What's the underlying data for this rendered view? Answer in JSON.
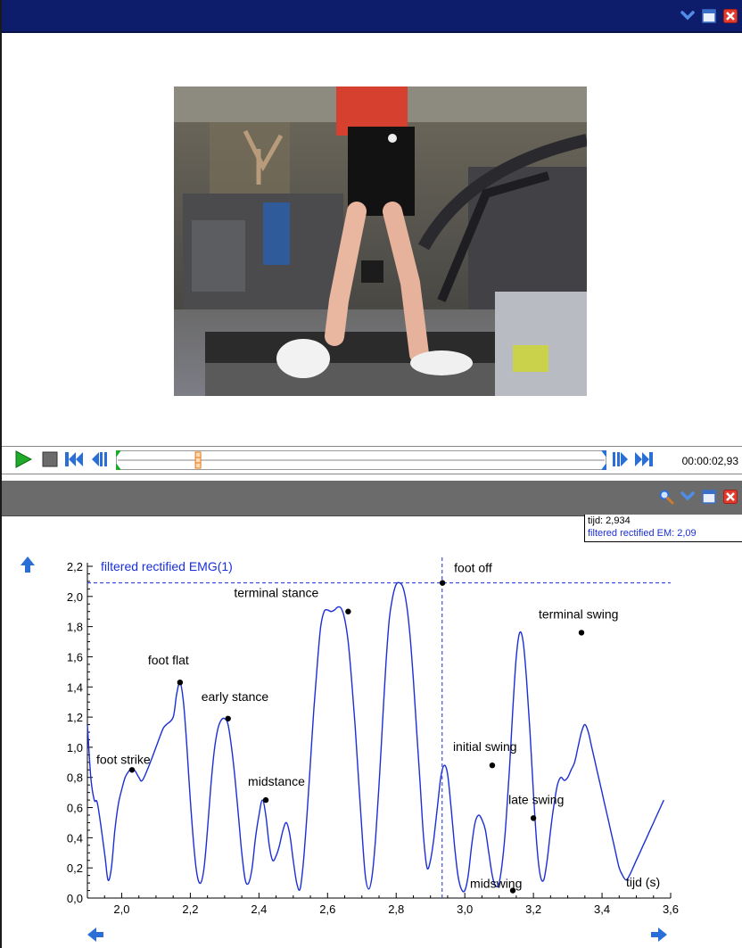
{
  "video": {
    "timecode": "00:00:02,93",
    "progress": 0.16
  },
  "tooltip": {
    "line1": "tijd: 2,934",
    "line2": "filtered rectified EM: 2,09"
  },
  "colors": {
    "video_titlebar": "#0d1d6b",
    "chart_titlebar": "#6b6b6b",
    "series": "#1a2fd6",
    "play_green": "#1faa2a",
    "nav_blue": "#2b6fd6"
  },
  "icons": {
    "video_titlebar": [
      "chevron-down-icon",
      "maximize-icon",
      "close-icon"
    ],
    "chart_titlebar": [
      "zoom-icon",
      "chevron-down-icon",
      "maximize-icon",
      "close-icon"
    ],
    "controls": [
      "play-icon",
      "stop-icon",
      "skip-start-icon",
      "step-back-icon",
      "step-forward-icon",
      "skip-end-icon"
    ]
  },
  "chart_data": {
    "type": "line",
    "series": [
      {
        "name": "filtered rectified EMG(1)",
        "x": [
          1.9,
          1.91,
          1.92,
          1.93,
          1.95,
          1.96,
          1.97,
          1.98,
          1.99,
          2.0,
          2.01,
          2.02,
          2.03,
          2.04,
          2.05,
          2.06,
          2.08,
          2.1,
          2.12,
          2.13,
          2.15,
          2.16,
          2.17,
          2.18,
          2.19,
          2.2,
          2.21,
          2.22,
          2.23,
          2.24,
          2.25,
          2.26,
          2.27,
          2.28,
          2.29,
          2.3,
          2.31,
          2.32,
          2.33,
          2.34,
          2.35,
          2.36,
          2.37,
          2.38,
          2.39,
          2.4,
          2.41,
          2.42,
          2.43,
          2.44,
          2.45,
          2.46,
          2.47,
          2.48,
          2.49,
          2.5,
          2.51,
          2.52,
          2.53,
          2.54,
          2.55,
          2.56,
          2.57,
          2.58,
          2.59,
          2.6,
          2.61,
          2.62,
          2.63,
          2.64,
          2.65,
          2.66,
          2.67,
          2.68,
          2.69,
          2.7,
          2.71,
          2.72,
          2.73,
          2.74,
          2.75,
          2.76,
          2.77,
          2.78,
          2.79,
          2.8,
          2.81,
          2.82,
          2.83,
          2.84,
          2.85,
          2.86,
          2.87,
          2.88,
          2.89,
          2.9,
          2.91,
          2.92,
          2.93,
          2.94,
          2.95,
          2.96,
          2.97,
          2.98,
          2.99,
          3.0,
          3.01,
          3.02,
          3.03,
          3.04,
          3.05,
          3.06,
          3.07,
          3.08,
          3.09,
          3.1,
          3.11,
          3.12,
          3.13,
          3.14,
          3.15,
          3.16,
          3.17,
          3.18,
          3.19,
          3.2,
          3.21,
          3.22,
          3.23,
          3.24,
          3.25,
          3.26,
          3.27,
          3.28,
          3.29,
          3.3,
          3.31,
          3.32,
          3.33,
          3.34,
          3.35,
          3.36,
          3.37,
          3.38,
          3.39,
          3.4,
          3.41,
          3.42,
          3.43,
          3.44,
          3.45,
          3.46,
          3.47,
          3.48,
          3.49,
          3.5,
          3.51,
          3.52,
          3.53,
          3.54,
          3.55,
          3.56,
          3.57,
          3.58
        ],
        "y": [
          1.15,
          0.8,
          0.65,
          0.62,
          0.3,
          0.12,
          0.2,
          0.45,
          0.62,
          0.72,
          0.8,
          0.84,
          0.86,
          0.84,
          0.8,
          0.78,
          0.88,
          1.0,
          1.12,
          1.15,
          1.2,
          1.35,
          1.43,
          1.3,
          1.0,
          0.65,
          0.35,
          0.15,
          0.1,
          0.2,
          0.45,
          0.75,
          0.98,
          1.12,
          1.18,
          1.19,
          1.15,
          1.0,
          0.8,
          0.55,
          0.3,
          0.12,
          0.1,
          0.2,
          0.4,
          0.55,
          0.65,
          0.55,
          0.35,
          0.25,
          0.28,
          0.35,
          0.45,
          0.5,
          0.42,
          0.25,
          0.1,
          0.06,
          0.25,
          0.55,
          0.9,
          1.25,
          1.55,
          1.8,
          1.9,
          1.91,
          1.9,
          1.91,
          1.93,
          1.92,
          1.85,
          1.7,
          1.45,
          1.15,
          0.8,
          0.45,
          0.15,
          0.06,
          0.15,
          0.4,
          0.75,
          1.15,
          1.55,
          1.85,
          2.0,
          2.08,
          2.09,
          2.06,
          1.95,
          1.75,
          1.45,
          1.1,
          0.75,
          0.4,
          0.2,
          0.25,
          0.4,
          0.6,
          0.8,
          0.88,
          0.82,
          0.6,
          0.35,
          0.15,
          0.06,
          0.05,
          0.15,
          0.35,
          0.5,
          0.55,
          0.52,
          0.45,
          0.3,
          0.15,
          0.08,
          0.1,
          0.25,
          0.5,
          0.85,
          1.25,
          1.6,
          1.76,
          1.7,
          1.45,
          1.1,
          0.7,
          0.35,
          0.15,
          0.12,
          0.25,
          0.45,
          0.62,
          0.75,
          0.8,
          0.78,
          0.8,
          0.85,
          0.9,
          1.0,
          1.1,
          1.15,
          1.1,
          1.0,
          0.9,
          0.8,
          0.7,
          0.6,
          0.5,
          0.4,
          0.3,
          0.2,
          0.15,
          0.12,
          0.15,
          0.2,
          0.25,
          0.3,
          0.35,
          0.4,
          0.45,
          0.5,
          0.55,
          0.6,
          0.65
        ]
      }
    ],
    "xlabel": "tijd (s)",
    "ylabel": "",
    "xlim": [
      1.9,
      3.6
    ],
    "ylim": [
      0.0,
      2.2
    ],
    "x_ticks": [
      "2,0",
      "2,2",
      "2,4",
      "2,6",
      "2,8",
      "3,0",
      "3,2",
      "3,4",
      "3,6"
    ],
    "x_tick_values": [
      2.0,
      2.2,
      2.4,
      2.6,
      2.8,
      3.0,
      3.2,
      3.4,
      3.6
    ],
    "y_ticks": [
      "0,0",
      "0,2",
      "0,4",
      "0,6",
      "0,8",
      "1,0",
      "1,2",
      "1,4",
      "1,6",
      "1,8",
      "2,0",
      "2,2"
    ],
    "y_tick_values": [
      0.0,
      0.2,
      0.4,
      0.6,
      0.8,
      1.0,
      1.2,
      1.4,
      1.6,
      1.8,
      2.0,
      2.2
    ],
    "cursor": {
      "x": 2.934,
      "y": 2.09
    },
    "annotations": [
      {
        "label": "foot strike",
        "x": 2.03,
        "y": 0.85
      },
      {
        "label": "foot flat",
        "x": 2.17,
        "y": 1.43
      },
      {
        "label": "early stance",
        "x": 2.31,
        "y": 1.19
      },
      {
        "label": "midstance",
        "x": 2.42,
        "y": 0.65
      },
      {
        "label": "terminal stance",
        "x": 2.66,
        "y": 1.9
      },
      {
        "label": "foot off",
        "x": 2.935,
        "y": 2.09
      },
      {
        "label": "initial swing",
        "x": 3.08,
        "y": 0.88
      },
      {
        "label": "midswing",
        "x": 3.14,
        "y": 0.05
      },
      {
        "label": "late swing",
        "x": 3.2,
        "y": 0.53
      },
      {
        "label": "terminal swing",
        "x": 3.34,
        "y": 1.76
      }
    ]
  }
}
